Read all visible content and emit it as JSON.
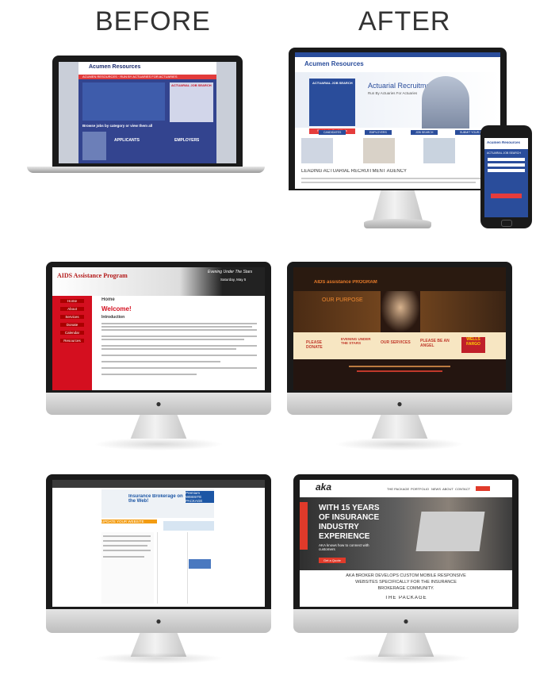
{
  "headings": {
    "before": "BEFORE",
    "after": "AFTER"
  },
  "acumen_old": {
    "logo": "Acumen Resources",
    "nav": "ACUMEN RESOURCES · RUN BY ACTUARIES FOR ACTUARIES",
    "search_title": "ACTUARIAL JOB SEARCH",
    "browse": "Browse jobs by category or view them all",
    "applicants": "APPLICANTS",
    "employers": "EMPLOYERS"
  },
  "acumen_new": {
    "logo": "Acumen Resources",
    "hero_title": "Actuarial Recruitment",
    "hero_sub": "Run By Actuaries For Actuaries",
    "search_title": "ACTUARIAL JOB SEARCH",
    "search_btn": "Register for Email Alerts",
    "tabs": [
      "CANDIDATES",
      "EMPLOYERS",
      "JOB SEARCH",
      "SUBMIT YOUR CV"
    ],
    "agency": "LEADING ACTUARIAL RECRUITMENT AGENCY",
    "mobile_logo": "Acumen Resources",
    "mobile_search": "ACTUARIAL JOB SEARCH"
  },
  "aids_old": {
    "logo": "AIDS Assistance Program",
    "promo": "Evening Under The Stars",
    "promo_date": "Saturday, May 5",
    "home": "Home",
    "welcome": "Welcome!",
    "intro": "Introduction",
    "menu": [
      "Home",
      "About",
      "Services",
      "Donate",
      "Calendar",
      "Resources"
    ]
  },
  "aids_new": {
    "logo": "AIDS assistance PROGRAM",
    "purpose": "OUR PURPOSE",
    "cta": [
      "PLEASE DONATE",
      "EVENING UNDER THE STARS",
      "OUR SERVICES",
      "PLEASE BE AN ANGEL"
    ],
    "sponsor": "WELLS FARGO"
  },
  "aka_old": {
    "banner": "Insurance Brokerage on the Web!",
    "premium": "Premium WEBSITE PACKAGE",
    "update": "UPDATE YOUR WEBSITE"
  },
  "aka_new": {
    "logo": "aka",
    "nav": [
      "THE PACKAGE",
      "PORTFOLIO",
      "NEWS",
      "ABOUT",
      "CONTACT"
    ],
    "hero": [
      "WITH 15 YEARS",
      "OF INSURANCE",
      "INDUSTRY",
      "EXPERIENCE"
    ],
    "hero_sub": "AKA knows how to connect with customers",
    "cta": "Get a Quote",
    "desc1": "AKA BROKER DEVELOPS CUSTOM MOBILE RESPONSIVE",
    "desc2": "WEBSITES SPECIFICALLY FOR THE INSURANCE",
    "desc3": "BROKERAGE COMMUNITY.",
    "package": "THE PACKAGE"
  },
  "colors": {
    "acumen_blue": "#2a4d9b",
    "aids_red": "#c8102e",
    "aka_red": "#e03a2a",
    "aka_dark": "#1f1f1f"
  }
}
